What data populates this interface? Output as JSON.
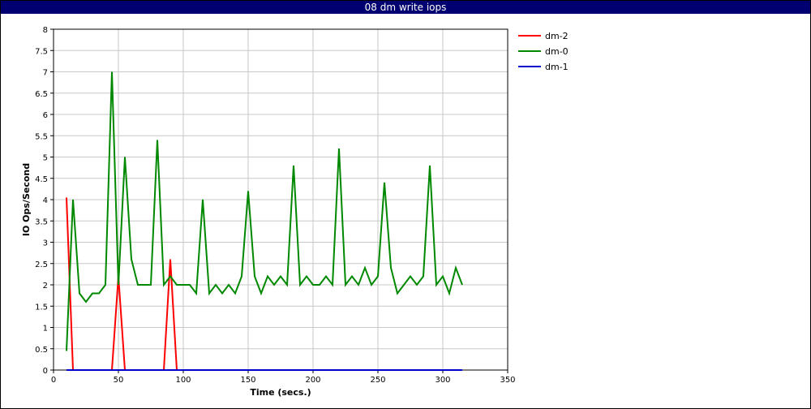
{
  "window": {
    "title": "08 dm write iops"
  },
  "chart_data": {
    "type": "line",
    "title": "08 dm write iops",
    "xlabel": "Time (secs.)",
    "ylabel": "IO Ops/Second",
    "xlim": [
      0,
      350
    ],
    "ylim": [
      0,
      8
    ],
    "xticks": [
      0,
      50,
      100,
      150,
      200,
      250,
      300,
      350
    ],
    "yticks": [
      0,
      0.5,
      1,
      1.5,
      2,
      2.5,
      3,
      3.5,
      4,
      4.5,
      5,
      5.5,
      6,
      6.5,
      7,
      7.5,
      8
    ],
    "grid": true,
    "legend_position": "right",
    "series": [
      {
        "name": "dm-2",
        "color": "#ff0000",
        "x": [
          10,
          15,
          20,
          25,
          30,
          35,
          40,
          45,
          50,
          55,
          60,
          65,
          70,
          75,
          80,
          85,
          90,
          95,
          100,
          150,
          200,
          250,
          300,
          315
        ],
        "y": [
          4.05,
          0,
          0,
          0,
          0,
          0,
          0,
          0,
          2.2,
          0,
          0,
          0,
          0,
          0,
          0,
          0,
          2.6,
          0,
          0,
          0,
          0,
          0,
          0,
          0
        ]
      },
      {
        "name": "dm-0",
        "color": "#008800",
        "x": [
          10,
          15,
          20,
          25,
          30,
          35,
          40,
          45,
          50,
          55,
          60,
          65,
          70,
          75,
          80,
          85,
          90,
          95,
          100,
          105,
          110,
          115,
          120,
          125,
          130,
          135,
          140,
          145,
          150,
          155,
          160,
          165,
          170,
          175,
          180,
          185,
          190,
          195,
          200,
          205,
          210,
          215,
          220,
          225,
          230,
          235,
          240,
          245,
          250,
          255,
          260,
          265,
          270,
          275,
          280,
          285,
          290,
          295,
          300,
          305,
          310,
          315
        ],
        "y": [
          0.45,
          4.0,
          1.8,
          1.6,
          1.8,
          1.8,
          2.0,
          7.0,
          2.0,
          5.0,
          2.6,
          2.0,
          2.0,
          2.0,
          5.4,
          2.0,
          2.2,
          2.0,
          2.0,
          2.0,
          1.8,
          4.0,
          1.8,
          2.0,
          1.8,
          2.0,
          1.8,
          2.2,
          4.2,
          2.2,
          1.8,
          2.2,
          2.0,
          2.2,
          2.0,
          4.8,
          2.0,
          2.2,
          2.0,
          2.0,
          2.2,
          2.0,
          5.2,
          2.0,
          2.2,
          2.0,
          2.4,
          2.0,
          2.2,
          4.4,
          2.4,
          1.8,
          2.0,
          2.2,
          2.0,
          2.2,
          4.8,
          2.0,
          2.2,
          1.8,
          2.4,
          2.0
        ]
      },
      {
        "name": "dm-1",
        "color": "#0000cc",
        "x": [
          10,
          50,
          100,
          150,
          200,
          250,
          300,
          315
        ],
        "y": [
          0,
          0,
          0,
          0,
          0,
          0,
          0,
          0
        ]
      }
    ]
  }
}
